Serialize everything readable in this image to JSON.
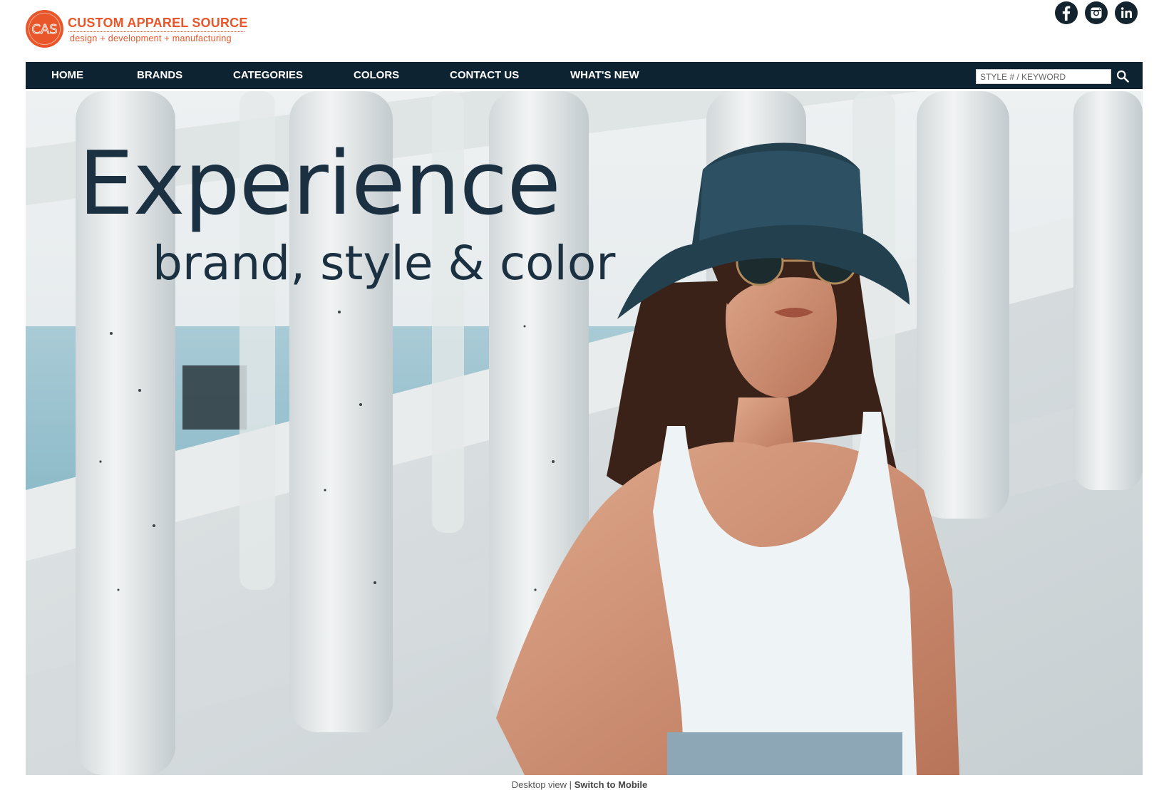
{
  "brand": {
    "name": "CUSTOM APPAREL SOURCE",
    "tagline": "design + development + manufacturing",
    "monogram": "CAS",
    "color": "#e8562a"
  },
  "social": [
    {
      "name": "facebook",
      "icon": "facebook-icon"
    },
    {
      "name": "instagram",
      "icon": "instagram-icon"
    },
    {
      "name": "linkedin",
      "icon": "linkedin-icon"
    }
  ],
  "nav": {
    "background": "#0e2331",
    "items": [
      "HOME",
      "BRANDS",
      "CATEGORIES",
      "COLORS",
      "CONTACT US",
      "WHAT'S NEW"
    ],
    "search": {
      "placeholder": "STYLE # / KEYWORD",
      "value": "",
      "icon": "search-icon"
    }
  },
  "hero": {
    "headline": "Experience",
    "subheadline": "brand, style & color",
    "text_color": "#1b3141"
  },
  "footer": {
    "view_label": "Desktop view",
    "separator": "|",
    "switch_label": "Switch to Mobile"
  }
}
